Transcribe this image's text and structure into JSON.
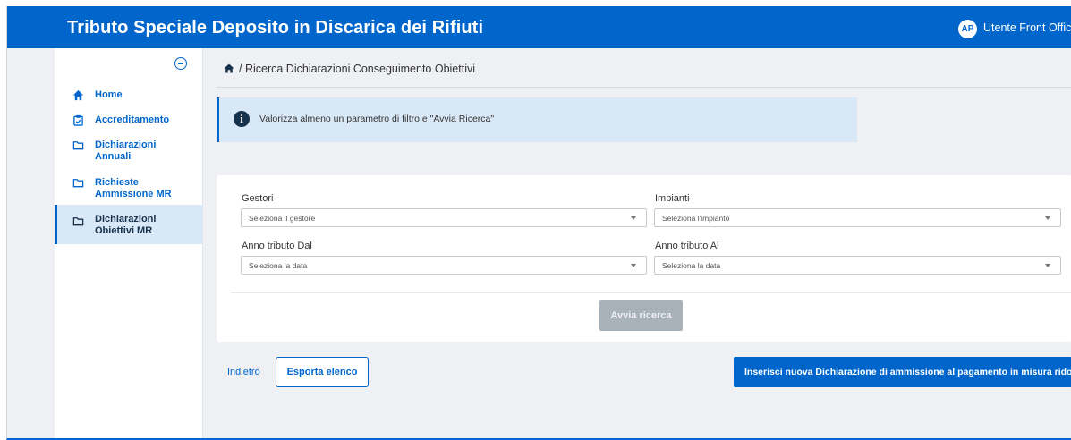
{
  "header": {
    "title": "Tributo Speciale Deposito in Discarica dei Rifiuti",
    "avatar_initials": "AP",
    "user_label": "Utente Front Office"
  },
  "sidebar": {
    "items": [
      {
        "label": "Home",
        "icon": "home-icon"
      },
      {
        "label": "Accreditamento",
        "icon": "clipboard-check-icon"
      },
      {
        "label": "Dichiarazioni Annuali",
        "icon": "folder-icon"
      },
      {
        "label": "Richieste Ammissione MR",
        "icon": "folder-icon"
      },
      {
        "label": "Dichiarazioni Obiettivi MR",
        "icon": "folder-icon",
        "active": true
      }
    ]
  },
  "breadcrumb": {
    "text": "/ Ricerca Dichiarazioni Conseguimento Obiettivi"
  },
  "alert": {
    "message": "Valorizza almeno un parametro di filtro e \"Avvia Ricerca\""
  },
  "filters": {
    "gestori_label": "Gestori",
    "gestori_placeholder": "Seleziona il gestore",
    "impianti_label": "Impianti",
    "impianti_placeholder": "Seleziona l'impianto",
    "anno_dal_label": "Anno tributo Dal",
    "anno_dal_placeholder": "Seleziona la data",
    "anno_al_label": "Anno tributo Al",
    "anno_al_placeholder": "Seleziona la data",
    "search_button": "Avvia ricerca"
  },
  "actions": {
    "back_label": "Indietro",
    "export_label": "Esporta elenco",
    "new_label": "Inserisci nuova Dichiarazione di ammissione al pagamento in misura ridotta"
  },
  "colors": {
    "primary": "#0066cc",
    "active_bg": "#d9e8f6",
    "disabled_button": "#a9b1b9"
  }
}
